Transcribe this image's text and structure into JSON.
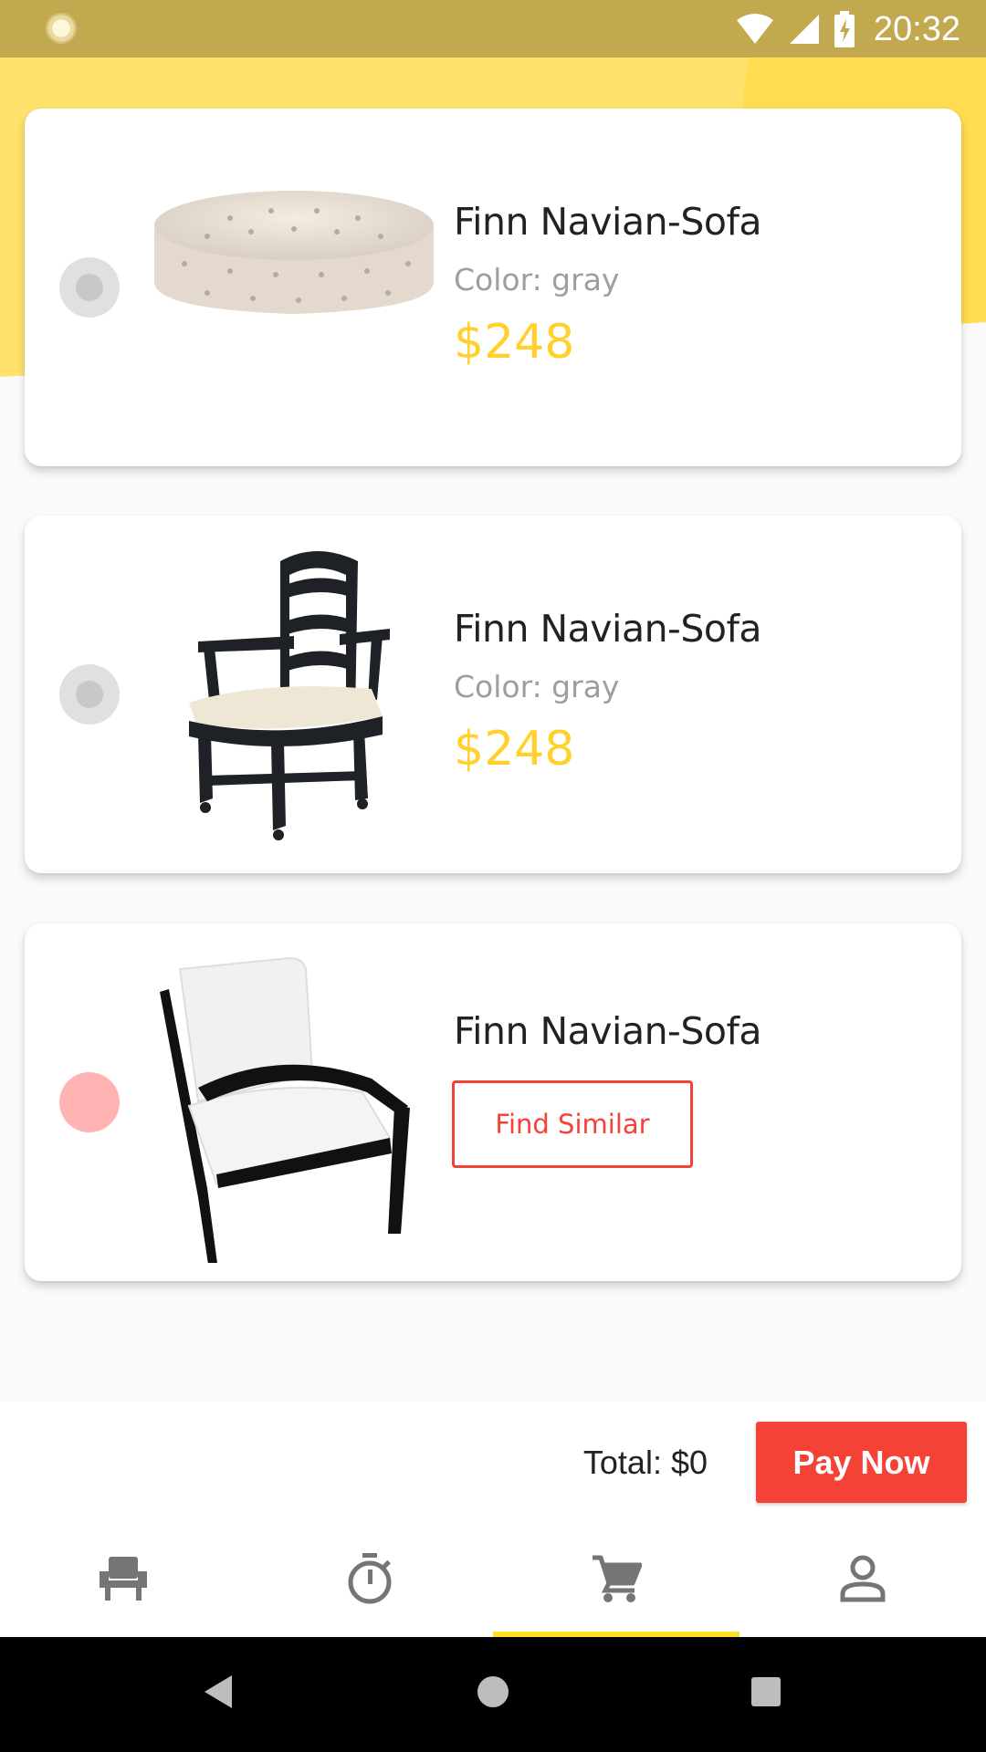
{
  "status_bar": {
    "time": "20:32"
  },
  "colors": {
    "accent": "#ffd12a",
    "danger": "#f44336",
    "status_bar": "#c2a94f"
  },
  "cart_items": [
    {
      "name": "Finn Navian-Sofa",
      "color_label": "Color: gray",
      "price": "$248",
      "image": "tufted-ottoman-image"
    },
    {
      "name": "Finn Navian-Sofa",
      "color_label": "Color: gray",
      "price": "$248",
      "image": "wooden-armchair-image"
    },
    {
      "name": "Finn Navian-Sofa",
      "action_label": "Find Similar",
      "image": "white-lounge-chair-image"
    }
  ],
  "checkout": {
    "total_label": "Total: $0",
    "pay_label": "Pay Now"
  },
  "bottom_nav": [
    {
      "icon": "chair-icon",
      "active": false
    },
    {
      "icon": "timer-icon",
      "active": false
    },
    {
      "icon": "cart-icon",
      "active": true
    },
    {
      "icon": "profile-icon",
      "active": false
    }
  ]
}
